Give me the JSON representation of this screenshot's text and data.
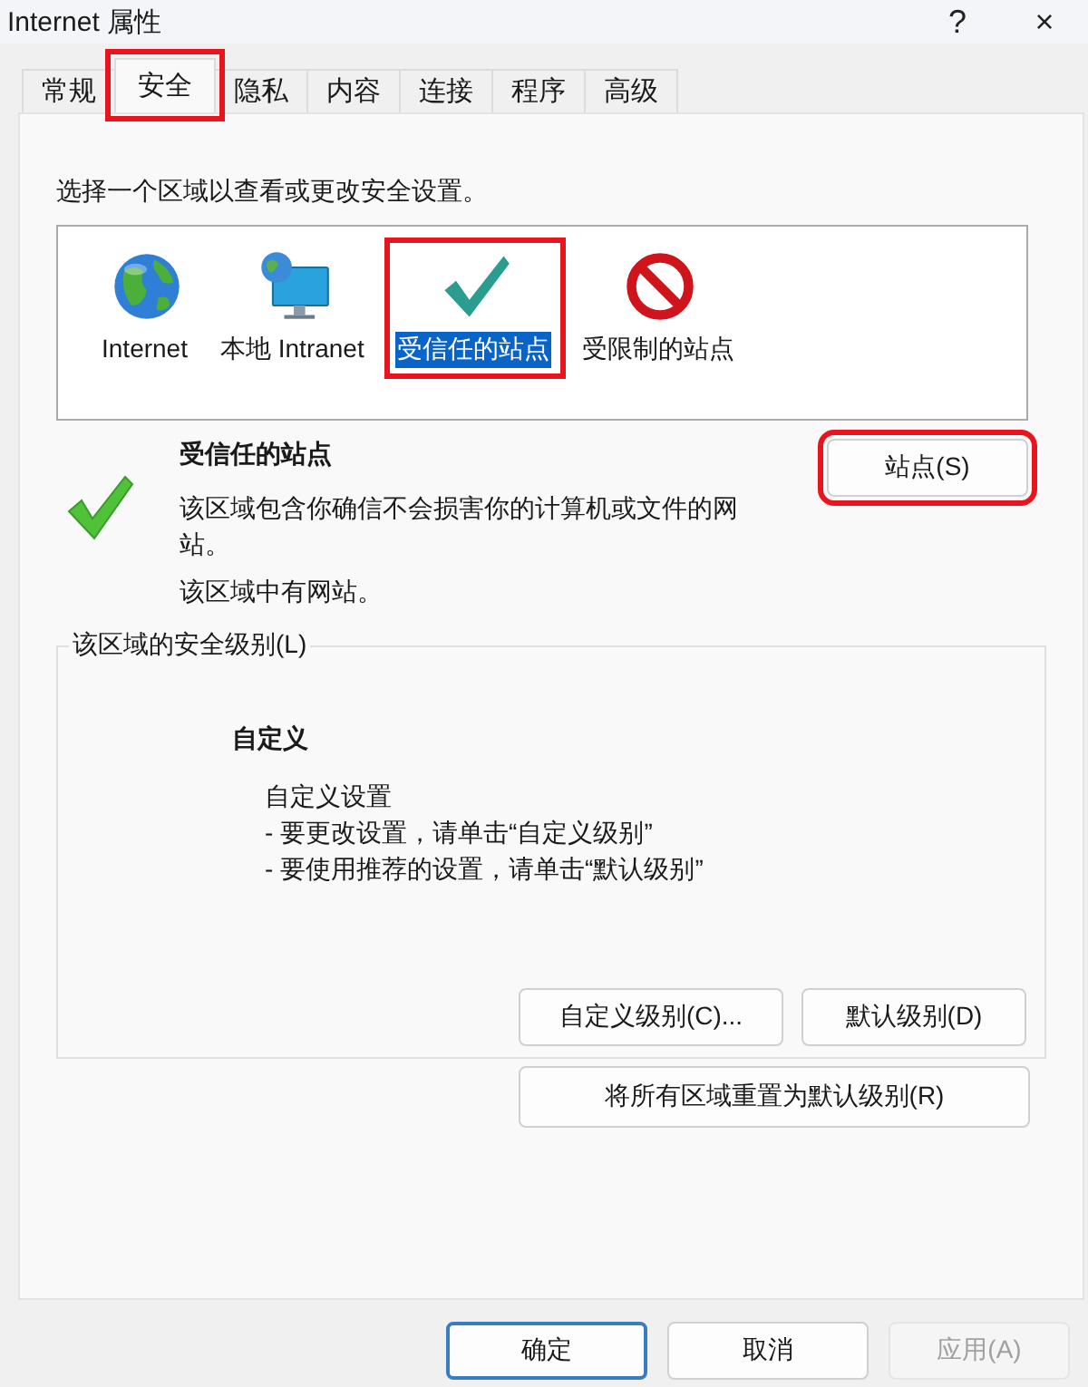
{
  "window": {
    "title": "Internet 属性",
    "help": "?",
    "close": "×"
  },
  "tabs": [
    {
      "label": "常规",
      "selected": false,
      "highlighted": false
    },
    {
      "label": "安全",
      "selected": true,
      "highlighted": true
    },
    {
      "label": "隐私",
      "selected": false,
      "highlighted": false
    },
    {
      "label": "内容",
      "selected": false,
      "highlighted": false
    },
    {
      "label": "连接",
      "selected": false,
      "highlighted": false
    },
    {
      "label": "程序",
      "selected": false,
      "highlighted": false
    },
    {
      "label": "高级",
      "selected": false,
      "highlighted": false
    }
  ],
  "prompt": "选择一个区域以查看或更改安全设置。",
  "zones": [
    {
      "kind": "internet",
      "label": "Internet",
      "selected": false,
      "highlighted": false
    },
    {
      "kind": "intranet",
      "label": "本地 Intranet",
      "selected": false,
      "highlighted": false
    },
    {
      "kind": "trusted",
      "label": "受信任的站点",
      "selected": true,
      "highlighted": true
    },
    {
      "kind": "restricted",
      "label": "受限制的站点",
      "selected": false,
      "highlighted": false
    }
  ],
  "zone_info": {
    "title": "受信任的站点",
    "description": "该区域包含你确信不会损害你的计算机或文件的网站。",
    "note": "该区域中有网站。"
  },
  "sites_button": {
    "label": "站点(S)",
    "highlighted": true
  },
  "security_level": {
    "legend": "该区域的安全级别(L)",
    "level_name": "自定义",
    "details": [
      "自定义设置",
      "- 要更改设置，请单击“自定义级别”",
      "- 要使用推荐的设置，请单击“默认级别”"
    ],
    "buttons": [
      "自定义级别(C)...",
      "默认级别(D)"
    ]
  },
  "reset_button": "将所有区域重置为默认级别(R)",
  "footer_buttons": [
    {
      "label": "确定",
      "default": true,
      "disabled": false
    },
    {
      "label": "取消",
      "default": false,
      "disabled": false
    },
    {
      "label": "应用(A)",
      "default": false,
      "disabled": true
    }
  ]
}
